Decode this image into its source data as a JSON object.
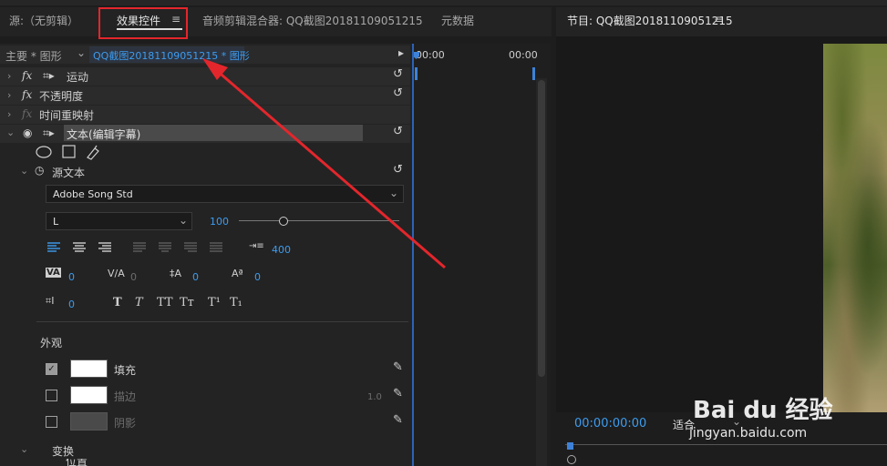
{
  "left_tabs": {
    "source": "源:（无剪辑）",
    "effect_controls": "效果控件",
    "effect_controls_menu": "≡",
    "audio_mixer": "音频剪辑混合器: QQ截图20181109051215",
    "metadata": "元数据"
  },
  "clip_header": {
    "master": "主要 * 图形",
    "chevron": "⌄",
    "clip": "QQ截图20181109051215 * 图形",
    "play_arrow": "▸"
  },
  "timeline": {
    "start_time": "00:00",
    "end_time": "00:00"
  },
  "effects": {
    "motion": "运动",
    "opacity": "不透明度",
    "time_remap": "时间重映射",
    "text": "文本(编辑字幕)"
  },
  "text_props": {
    "source_text": "源文本",
    "font_family": "Adobe Song Std",
    "font_style": "L",
    "font_size": "100",
    "font_size_fraction": 0.27,
    "tab_width": "400",
    "kerning": "0",
    "tracking": "0",
    "leading": "0",
    "baseline_shift": "0",
    "tsume": "0",
    "style_buttons": [
      "T",
      "T",
      "TT",
      "Tт",
      "T¹",
      "T₁"
    ]
  },
  "appearance": {
    "section": "外观",
    "fill_label": "填充",
    "stroke_label": "描边",
    "stroke_width": "1.0",
    "shadow_label": "阴影",
    "fill_checked": true,
    "stroke_checked": false,
    "shadow_checked": false,
    "fill_color": "#ffffff",
    "stroke_color": "#ffffff",
    "shadow_color": "#4a4a4a"
  },
  "transform": {
    "section": "变换",
    "position_partial": "位置"
  },
  "program_monitor": {
    "title": "节目: QQ截图20181109051215",
    "menu": "≡",
    "timecode": "00:00:00:00",
    "fit": "适合",
    "fit_chevron": "⌄"
  },
  "watermark": {
    "brand": "Bai du 经验",
    "url": "jingyan.baidu.com"
  },
  "colors": {
    "accent_blue": "#3d9cf0",
    "highlight_red": "#e3262c"
  }
}
